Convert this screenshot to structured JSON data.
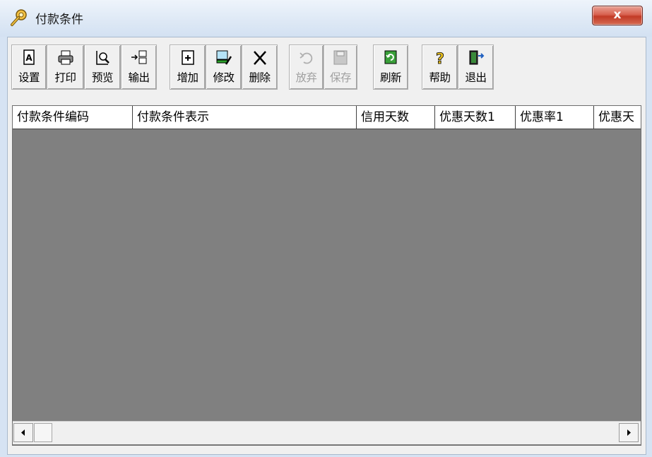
{
  "window": {
    "title": "付款条件",
    "close_label": "x"
  },
  "toolbar": {
    "buttons": [
      {
        "id": "settings",
        "label": "设置",
        "icon": "page-settings-icon",
        "enabled": true
      },
      {
        "id": "print",
        "label": "打印",
        "icon": "printer-icon",
        "enabled": true
      },
      {
        "id": "preview",
        "label": "预览",
        "icon": "print-preview-icon",
        "enabled": true
      },
      {
        "id": "export",
        "label": "输出",
        "icon": "export-icon",
        "enabled": true
      },
      {
        "id": "add",
        "label": "增加",
        "icon": "add-document-icon",
        "enabled": true
      },
      {
        "id": "edit",
        "label": "修改",
        "icon": "edit-icon",
        "enabled": true
      },
      {
        "id": "delete",
        "label": "删除",
        "icon": "delete-x-icon",
        "enabled": true
      },
      {
        "id": "discard",
        "label": "放弃",
        "icon": "undo-icon",
        "enabled": false
      },
      {
        "id": "save",
        "label": "保存",
        "icon": "floppy-disk-icon",
        "enabled": false
      },
      {
        "id": "refresh",
        "label": "刷新",
        "icon": "refresh-icon",
        "enabled": true
      },
      {
        "id": "help",
        "label": "帮助",
        "icon": "help-question-icon",
        "enabled": true
      },
      {
        "id": "exit",
        "label": "退出",
        "icon": "exit-door-icon",
        "enabled": true
      }
    ]
  },
  "grid": {
    "columns": [
      "付款条件编码",
      "付款条件表示",
      "信用天数",
      "优惠天数1",
      "优惠率1",
      "优惠天"
    ],
    "rows": []
  },
  "colors": {
    "grid_background": "#808080",
    "close_button": "#c9422c",
    "titlebar": "#dde8f5"
  }
}
